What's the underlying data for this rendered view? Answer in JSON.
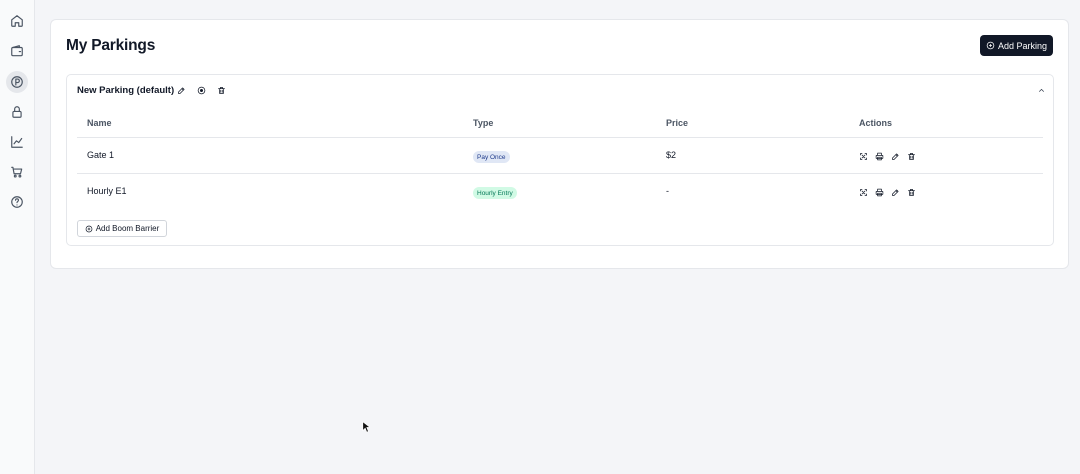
{
  "sidebar": {
    "items": [
      {
        "icon": "home-icon",
        "active": false
      },
      {
        "icon": "wallet-icon",
        "active": false
      },
      {
        "icon": "parking-icon",
        "active": true
      },
      {
        "icon": "lock-icon",
        "active": false
      },
      {
        "icon": "chart-icon",
        "active": false
      },
      {
        "icon": "cart-icon",
        "active": false
      },
      {
        "icon": "help-icon",
        "active": false
      }
    ]
  },
  "header": {
    "title": "My Parkings",
    "add_parking_label": "Add Parking"
  },
  "parking": {
    "name": "New Parking (default)",
    "tools": [
      "edit-icon",
      "target-icon",
      "trash-icon"
    ],
    "columns": [
      "Name",
      "Type",
      "Price",
      "Actions"
    ],
    "rows": [
      {
        "name": "Gate 1",
        "type": "Pay Once",
        "type_color": "blue",
        "price": "$2"
      },
      {
        "name": "Hourly E1",
        "type": "Hourly Entry",
        "type_color": "green",
        "price": "-"
      }
    ],
    "row_actions": [
      "scan-icon",
      "print-icon",
      "edit-icon",
      "trash-icon"
    ],
    "add_barrier_label": "Add Boom Barrier"
  },
  "colors": {
    "primary_button": "#111827",
    "badge_blue_bg": "#e0e7f5",
    "badge_green_bg": "#d1fae5"
  }
}
